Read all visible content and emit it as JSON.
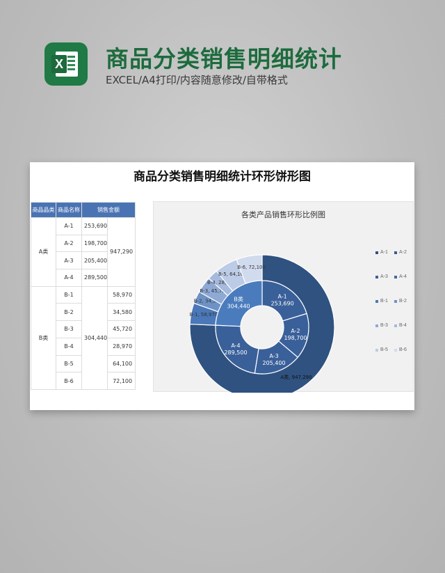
{
  "header": {
    "title": "商品分类销售明细统计",
    "subtitle": "EXCEL/A4打印/内容随意修改/自带格式",
    "logo_letter": "X"
  },
  "sheet": {
    "title": "商品分类销售明细统计环形饼形图",
    "table": {
      "headers": [
        "商品品类",
        "商品名称",
        "销售金额"
      ],
      "groups": [
        {
          "category": "A类",
          "total": "947,290",
          "items": [
            {
              "name": "A-1",
              "amount": "253,690"
            },
            {
              "name": "A-2",
              "amount": "198,700"
            },
            {
              "name": "A-3",
              "amount": "205,400"
            },
            {
              "name": "A-4",
              "amount": "289,500"
            }
          ]
        },
        {
          "category": "B类",
          "total": "304,440",
          "items": [
            {
              "name": "B-1",
              "amount": "58,970"
            },
            {
              "name": "B-2",
              "amount": "34,580"
            },
            {
              "name": "B-3",
              "amount": "45,720"
            },
            {
              "name": "B-4",
              "amount": "28,970"
            },
            {
              "name": "B-5",
              "amount": "64,100"
            },
            {
              "name": "B-6",
              "amount": "72,100"
            }
          ]
        }
      ]
    }
  },
  "chart_data": {
    "type": "pie",
    "title": "各类产品销售环形比例图",
    "subtype": "doughnut",
    "outer_ring": [
      {
        "name": "A类",
        "value": 947290,
        "label": "A类, 947,290",
        "color": "#2f5280"
      },
      {
        "name": "B-1",
        "value": 58970,
        "label": "B-1, 58,970",
        "color": "#4a78b8"
      },
      {
        "name": "B-2",
        "value": 34580,
        "label": "B-2, 34,580",
        "color": "#6e92c6"
      },
      {
        "name": "B-3",
        "value": 45720,
        "label": "B-3, 45,720",
        "color": "#8ea9d4"
      },
      {
        "name": "B-4",
        "value": 28970,
        "label": "B-4, 28,970",
        "color": "#a5badd"
      },
      {
        "name": "B-5",
        "value": 64100,
        "label": "B-5, 64,100",
        "color": "#bccbe6"
      },
      {
        "name": "B-6",
        "value": 72100,
        "label": "B-6, 72,100",
        "color": "#d0dbee"
      }
    ],
    "inner_ring": [
      {
        "name": "A-1",
        "value": 253690,
        "value_label": "253,690",
        "color": "#3a609a"
      },
      {
        "name": "A-2",
        "value": 198700,
        "value_label": "198,700",
        "color": "#3a609a"
      },
      {
        "name": "A-3",
        "value": 205400,
        "value_label": "205,400",
        "color": "#3a609a"
      },
      {
        "name": "A-4",
        "value": 289500,
        "value_label": "289,500",
        "color": "#3a609a"
      },
      {
        "name": "B类",
        "value": 304440,
        "value_label": "304,440",
        "color": "#4a7cbd"
      }
    ],
    "legend": {
      "position": "right",
      "items": [
        {
          "label": "A-1",
          "color": "#2f5280"
        },
        {
          "label": "A-2",
          "color": "#355b91"
        },
        {
          "label": "A-3",
          "color": "#3a609a"
        },
        {
          "label": "A-4",
          "color": "#3f67a4"
        },
        {
          "label": "B-1",
          "color": "#4a78b8"
        },
        {
          "label": "B-2",
          "color": "#6e92c6"
        },
        {
          "label": "B-3",
          "color": "#8ea9d4"
        },
        {
          "label": "B-4",
          "color": "#a5badd"
        },
        {
          "label": "B-5",
          "color": "#bccbe6"
        },
        {
          "label": "B-6",
          "color": "#d0dbee"
        }
      ]
    }
  }
}
